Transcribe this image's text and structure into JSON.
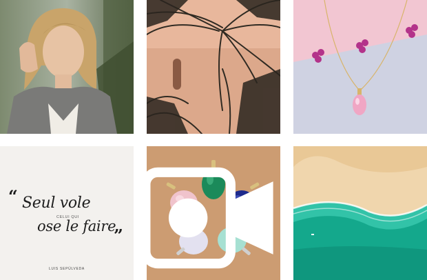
{
  "feed": {
    "tiles": [
      {
        "kind": "photo",
        "subject": "woman-portrait"
      },
      {
        "kind": "photo",
        "subject": "palm-trees-pink-wall"
      },
      {
        "kind": "photo",
        "subject": "pink-stone-pendant-necklace"
      },
      {
        "kind": "quote",
        "quote_open": "“",
        "line1": "Seul vole",
        "small": "CELUI QUI",
        "line2": "ose le faire",
        "quote_close": "”",
        "author": "LUIS SEPÚLVEDA"
      },
      {
        "kind": "video",
        "subject": "gemstone-charms",
        "badge_icon": "video-camera-icon"
      },
      {
        "kind": "photo",
        "subject": "aerial-beach"
      }
    ]
  },
  "colors": {
    "background": "#ffffff",
    "quote_background": "#f3f1ee",
    "quote_text": "#1d1d1d"
  }
}
